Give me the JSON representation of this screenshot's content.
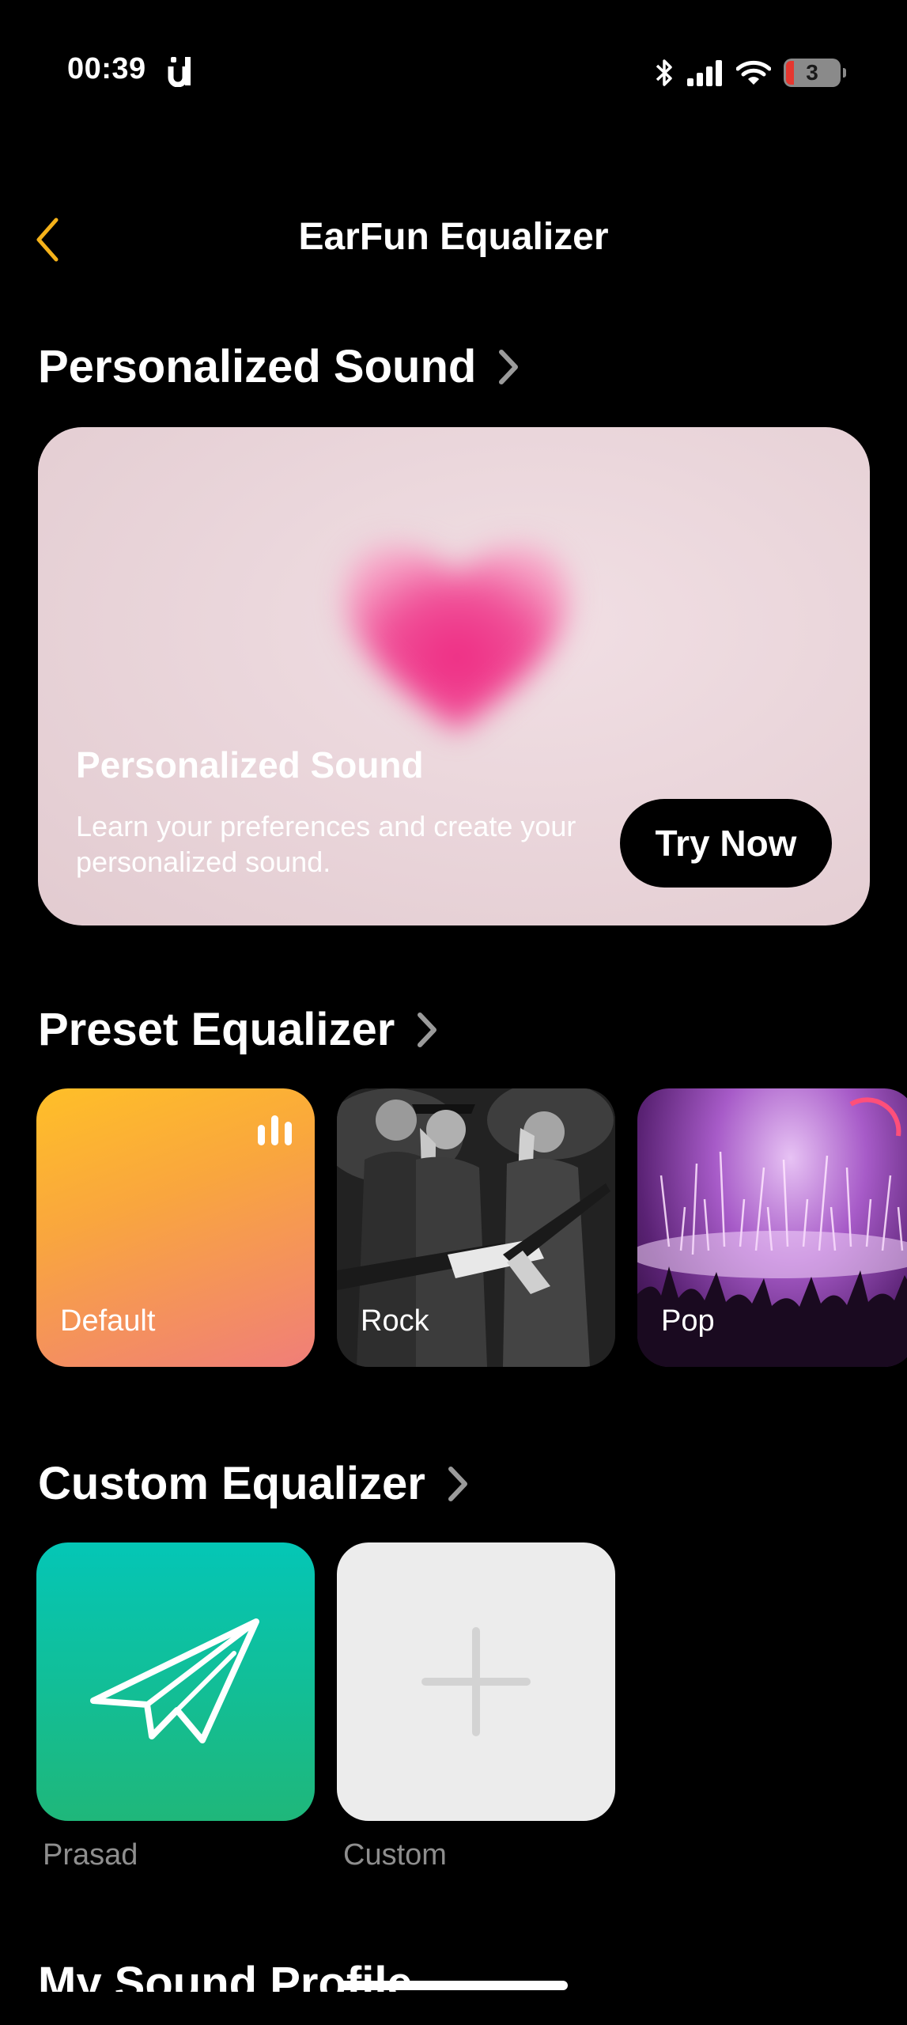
{
  "status_bar": {
    "time": "00:39",
    "battery": "3"
  },
  "nav": {
    "title": "EarFun Equalizer",
    "accent_color": "#f5b21a"
  },
  "personalized": {
    "section_title": "Personalized Sound",
    "card_title": "Personalized Sound",
    "card_description": "Learn your preferences and create your personalized sound.",
    "button_label": "Try Now"
  },
  "preset": {
    "section_title": "Preset Equalizer",
    "items": [
      {
        "label": "Default",
        "selected": true
      },
      {
        "label": "Rock"
      },
      {
        "label": "Pop"
      }
    ]
  },
  "custom": {
    "section_title": "Custom Equalizer",
    "items": [
      {
        "label": "Prasad",
        "icon": "paper-plane-icon"
      },
      {
        "label": "Custom",
        "icon": "plus-icon"
      }
    ]
  },
  "next_section": {
    "title": "My Sound Profile"
  }
}
